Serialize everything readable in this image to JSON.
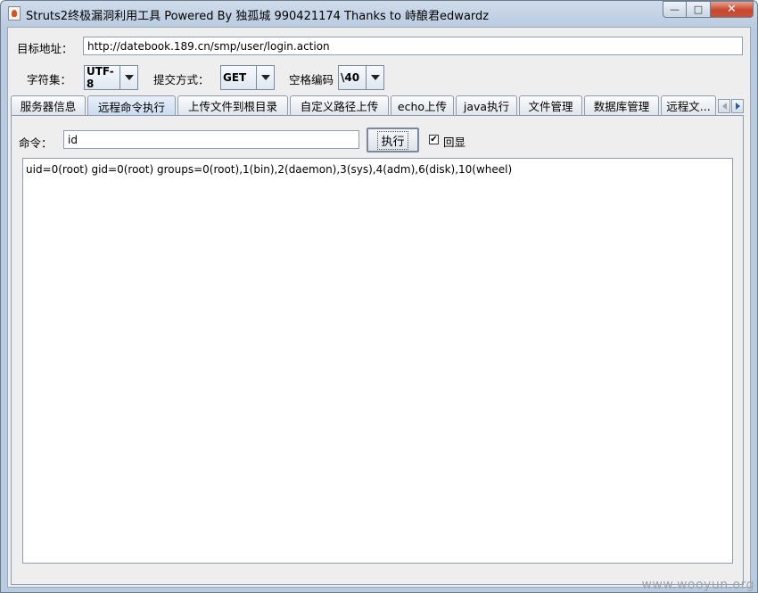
{
  "window": {
    "title": "Struts2终极漏洞利用工具  Powered By 独孤城 990421174 Thanks to 峙酿君edwardz",
    "controls": {
      "minimize": "—",
      "maximize": "□",
      "close": "✕"
    }
  },
  "target": {
    "label": "目标地址：",
    "value": "http://datebook.189.cn/smp/user/login.action"
  },
  "options": {
    "charset_label": "字符集：",
    "charset_value": "UTF-8",
    "method_label": "提交方式：",
    "method_value": "GET",
    "space_label": "空格编码",
    "space_value": "\\40"
  },
  "tabs": [
    {
      "label": "服务器信息"
    },
    {
      "label": "远程命令执行",
      "active": true
    },
    {
      "label": "上传文件到根目录"
    },
    {
      "label": "自定义路径上传"
    },
    {
      "label": "echo上传"
    },
    {
      "label": "java执行"
    },
    {
      "label": "文件管理"
    },
    {
      "label": "数据库管理"
    },
    {
      "label": "远程文..."
    }
  ],
  "command": {
    "label": "命令：",
    "value": "id",
    "execute_label": "执行",
    "echo_label": "回显",
    "echo_checked": true,
    "checkbox_mark": "✔"
  },
  "output": "uid=0(root) gid=0(root) groups=0(root),1(bin),2(daemon),3(sys),4(adm),6(disk),10(wheel)",
  "watermark": "www.wooyun.org"
}
